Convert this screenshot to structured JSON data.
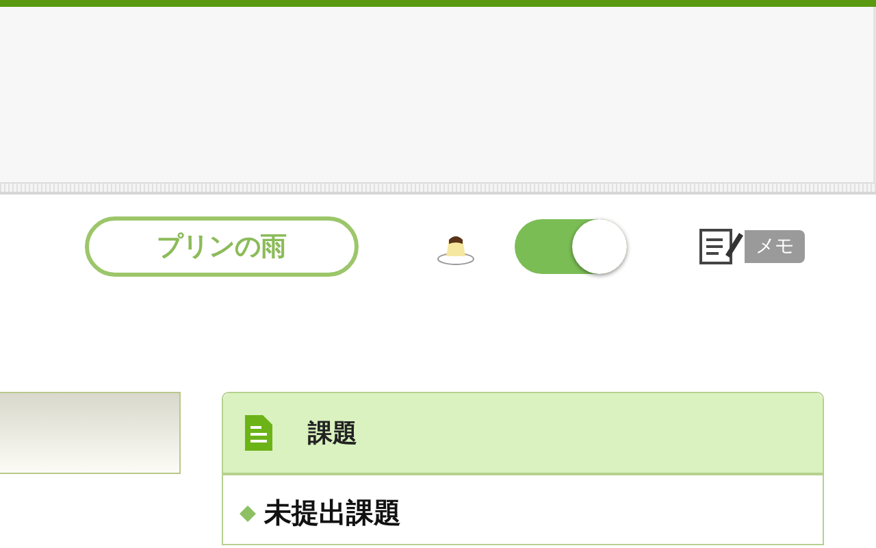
{
  "toolbar": {
    "rain_button": "プリンの雨",
    "pudding_toggle": {
      "on": true
    },
    "memo_button": "メモ"
  },
  "assignments": {
    "title": "課題",
    "items": [
      "未提出課題"
    ]
  }
}
